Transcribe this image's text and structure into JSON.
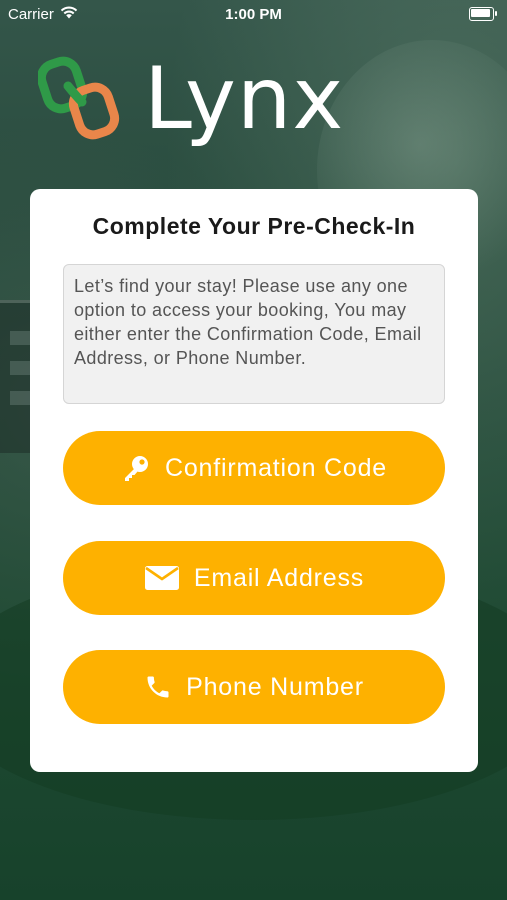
{
  "status_bar": {
    "carrier": "Carrier",
    "time": "1:00 PM",
    "battery_level": 1.0
  },
  "app": {
    "name": "Lynx",
    "logo_colors": {
      "green": "#2f9a48",
      "orange": "#e9864a"
    }
  },
  "card": {
    "title": "Complete Your Pre-Check-In",
    "instructions": "Let’s find your stay! Please use any one option to access your booking, You may either enter the Confirmation Code, Email Address, or Phone Number."
  },
  "options": {
    "confirmation_code": {
      "label": "Confirmation Code",
      "icon": "key-icon"
    },
    "email_address": {
      "label": "Email Address",
      "icon": "envelope-icon"
    },
    "phone_number": {
      "label": "Phone Number",
      "icon": "phone-icon"
    }
  },
  "colors": {
    "button": "#feb100",
    "background": "#24493a",
    "card": "#ffffff"
  }
}
